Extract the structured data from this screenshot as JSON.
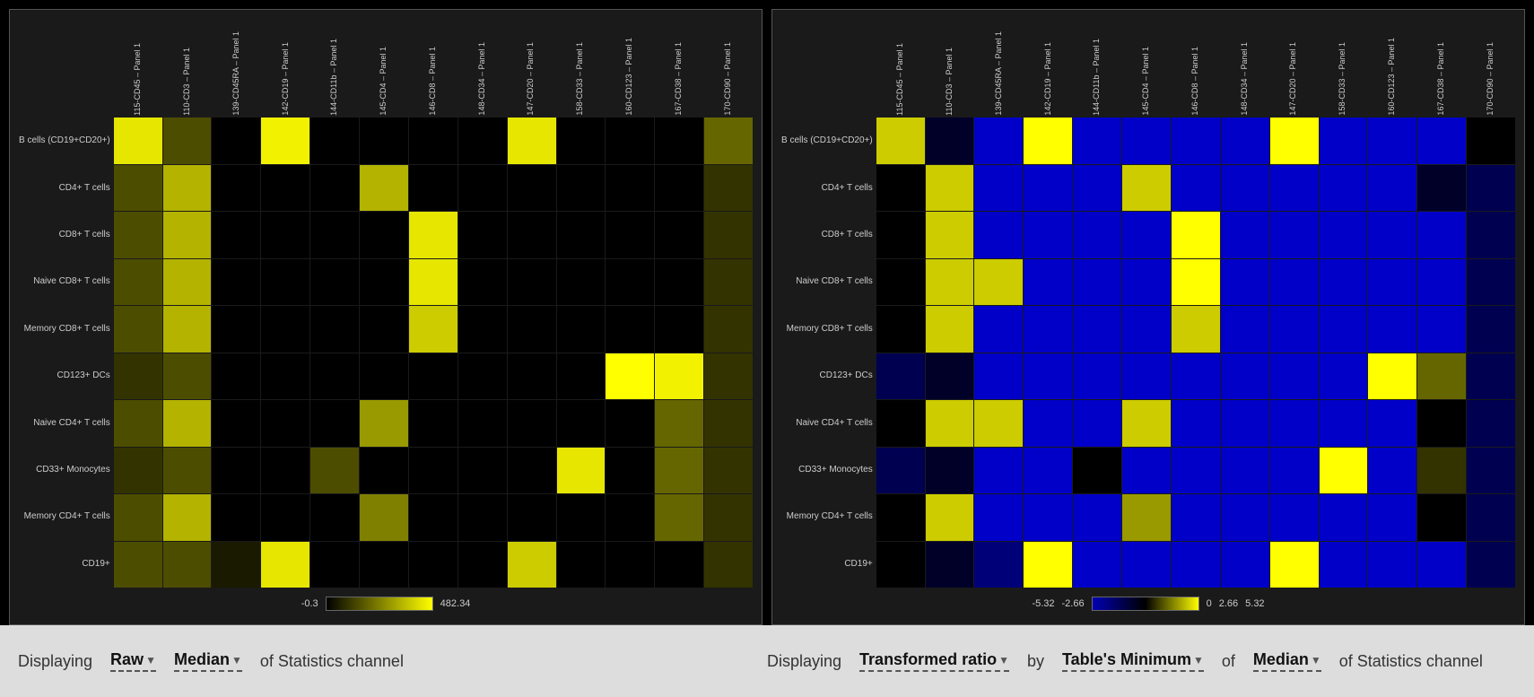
{
  "panels": [
    {
      "id": "left-panel",
      "col_labels": [
        "115-CD45 – Panel 1",
        "110-CD3 – Panel 1",
        "139-CD45RA – Panel 1",
        "142-CD19 – Panel 1",
        "144-CD11b – Panel 1",
        "145-CD4 – Panel 1",
        "146-CD8 – Panel 1",
        "148-CD34 – Panel 1",
        "147-CD20 – Panel 1",
        "158-CD33 – Panel 1",
        "160-CD123 – Panel 1",
        "167-CD38 – Panel 1",
        "170-CD90 – Panel 1"
      ],
      "row_labels": [
        "B cells (CD19+CD20+)",
        "CD4+ T cells",
        "CD8+ T cells",
        "Naive CD8+ T cells",
        "Memory CD8+ T cells",
        "CD123+ DCs",
        "Naive CD4+ T cells",
        "CD33+ Monocytes",
        "Memory CD4+ T cells",
        "CD19+"
      ],
      "legend_min": "-0.3",
      "legend_max": "482.34",
      "cells": [
        [
          0.9,
          0.3,
          0.0,
          0.95,
          0.0,
          0.0,
          0.0,
          0.0,
          0.9,
          0.0,
          0.0,
          0.0,
          0.4
        ],
        [
          0.3,
          0.7,
          0.0,
          0.0,
          0.0,
          0.7,
          0.0,
          0.0,
          0.0,
          0.0,
          0.0,
          0.0,
          0.2
        ],
        [
          0.3,
          0.7,
          0.0,
          0.0,
          0.0,
          0.0,
          0.9,
          0.0,
          0.0,
          0.0,
          0.0,
          0.0,
          0.2
        ],
        [
          0.3,
          0.7,
          0.0,
          0.0,
          0.0,
          0.0,
          0.9,
          0.0,
          0.0,
          0.0,
          0.0,
          0.0,
          0.2
        ],
        [
          0.3,
          0.7,
          0.0,
          0.0,
          0.0,
          0.0,
          0.8,
          0.0,
          0.0,
          0.0,
          0.0,
          0.0,
          0.2
        ],
        [
          0.2,
          0.3,
          0.0,
          0.0,
          0.0,
          0.0,
          0.0,
          0.0,
          0.0,
          0.0,
          1.0,
          0.95,
          0.2
        ],
        [
          0.3,
          0.7,
          0.0,
          0.0,
          0.0,
          0.6,
          0.0,
          0.0,
          0.0,
          0.0,
          0.0,
          0.4,
          0.2
        ],
        [
          0.2,
          0.3,
          0.0,
          0.0,
          0.3,
          0.0,
          0.0,
          0.0,
          0.0,
          0.9,
          0.0,
          0.4,
          0.2
        ],
        [
          0.3,
          0.7,
          0.0,
          0.0,
          0.0,
          0.5,
          0.0,
          0.0,
          0.0,
          0.0,
          0.0,
          0.4,
          0.2
        ],
        [
          0.3,
          0.3,
          0.1,
          0.9,
          0.0,
          0.0,
          0.0,
          0.0,
          0.8,
          0.0,
          0.0,
          0.0,
          0.2
        ]
      ]
    },
    {
      "id": "right-panel",
      "col_labels": [
        "115-CD45 – Panel 1",
        "110-CD3 – Panel 1",
        "139-CD45RA – Panel 1",
        "142-CD19 – Panel 1",
        "144-CD11b – Panel 1",
        "145-CD4 – Panel 1",
        "146-CD8 – Panel 1",
        "148-CD34 – Panel 1",
        "147-CD20 – Panel 1",
        "158-CD33 – Panel 1",
        "160-CD123 – Panel 1",
        "167-CD38 – Panel 1",
        "170-CD90 – Panel 1"
      ],
      "row_labels": [
        "B cells (CD19+CD20+)",
        "CD4+ T cells",
        "CD8+ T cells",
        "Naive CD8+ T cells",
        "Memory CD8+ T cells",
        "CD123+ DCs",
        "Naive CD4+ T cells",
        "CD33+ Monocytes",
        "Memory CD4+ T cells",
        "CD19+"
      ],
      "legend_min": "-5.32",
      "legend_mid_neg": "-2.66",
      "legend_zero": "0",
      "legend_mid_pos": "2.66",
      "legend_max": "5.32",
      "cells": [
        [
          0.9,
          0.4,
          0.0,
          1.0,
          0.0,
          0.0,
          0.0,
          0.0,
          1.0,
          0.0,
          0.0,
          0.0,
          0.5
        ],
        [
          0.5,
          0.9,
          0.0,
          0.0,
          0.0,
          0.9,
          0.0,
          0.0,
          0.0,
          0.0,
          0.0,
          0.4,
          0.3
        ],
        [
          0.5,
          0.9,
          0.0,
          0.0,
          0.0,
          0.0,
          1.0,
          0.0,
          0.0,
          0.0,
          0.0,
          0.0,
          0.3
        ],
        [
          0.5,
          0.9,
          0.9,
          0.0,
          0.0,
          0.0,
          1.0,
          0.0,
          0.0,
          0.0,
          0.0,
          0.0,
          0.3
        ],
        [
          0.5,
          0.9,
          0.0,
          0.0,
          0.0,
          0.0,
          0.9,
          0.0,
          0.0,
          0.0,
          0.0,
          0.0,
          0.3
        ],
        [
          0.3,
          0.4,
          0.0,
          0.0,
          0.0,
          0.0,
          0.0,
          0.0,
          0.0,
          0.0,
          1.0,
          0.7,
          0.3
        ],
        [
          0.5,
          0.9,
          0.9,
          0.0,
          0.0,
          0.9,
          0.0,
          0.0,
          0.0,
          0.0,
          0.0,
          0.5,
          0.3
        ],
        [
          0.3,
          0.4,
          0.0,
          0.0,
          0.5,
          0.0,
          0.0,
          0.0,
          0.0,
          1.0,
          0.0,
          0.6,
          0.3
        ],
        [
          0.5,
          0.9,
          0.0,
          0.0,
          0.0,
          0.8,
          0.0,
          0.0,
          0.0,
          0.0,
          0.0,
          0.5,
          0.3
        ],
        [
          0.5,
          0.4,
          0.2,
          1.0,
          0.0,
          0.0,
          0.0,
          0.0,
          1.0,
          0.0,
          0.0,
          0.0,
          0.3
        ]
      ]
    }
  ],
  "bottom_left": {
    "displaying": "Displaying",
    "dropdown1": "Raw",
    "dropdown1_arrow": "▼",
    "dropdown2": "Median",
    "dropdown2_arrow": "▼",
    "suffix": "of Statistics channel"
  },
  "bottom_right": {
    "displaying": "Displaying",
    "dropdown1": "Transformed ratio",
    "dropdown1_arrow": "▼",
    "by": "by",
    "dropdown2": "Table's Minimum",
    "dropdown2_arrow": "▼",
    "of": "of",
    "dropdown3": "Median",
    "dropdown3_arrow": "▼",
    "suffix": "of Statistics channel"
  }
}
